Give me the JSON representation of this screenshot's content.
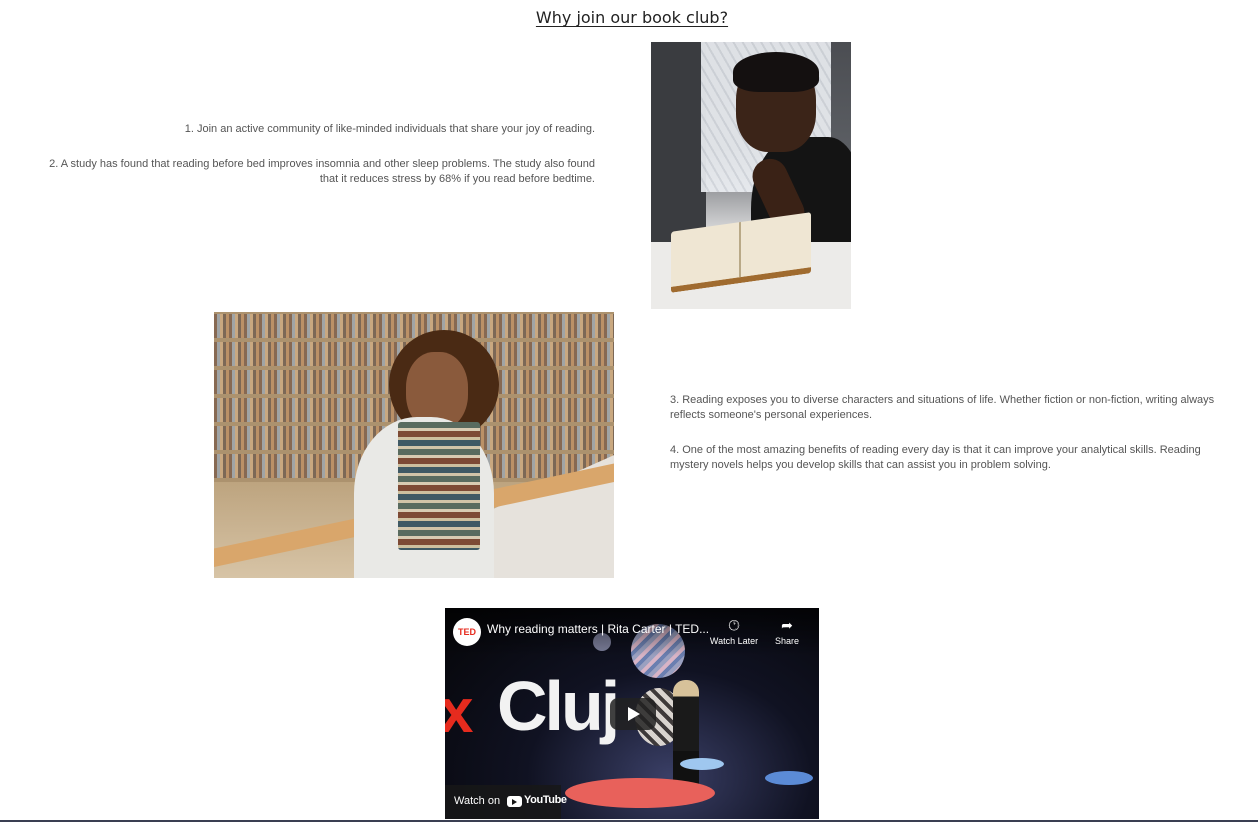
{
  "section": {
    "title": "Why join our book club?"
  },
  "reasons": [
    "1. Join an active community of like-minded individuals that share your joy of reading.",
    "2. A study has found that reading before bed improves insomnia and other sleep problems. The study also found that it reduces stress by 68% if you read before bedtime.",
    "3. Reading exposes you to diverse characters and situations of life. Whether fiction or non-fiction, writing always reflects someone's personal experiences.",
    "4. One of the most amazing benefits of reading every day is that it can improve your analytical skills. Reading mystery novels helps you develop skills that can assist you in problem solving."
  ],
  "video": {
    "channel_logo": "TED",
    "title": "Why reading matters | Rita Carter | TED...",
    "watch_later_label": "Watch Later",
    "share_label": "Share",
    "watch_on_label": "Watch on",
    "youtube_label": "YouTube",
    "stage_text_left": "x",
    "stage_text_main": "Cluj",
    "icons": {
      "watch_later": "clock-icon",
      "share": "share-arrow-icon",
      "play": "play-icon",
      "youtube": "youtube-logo-icon"
    },
    "accent_color": "#e62b1e"
  }
}
